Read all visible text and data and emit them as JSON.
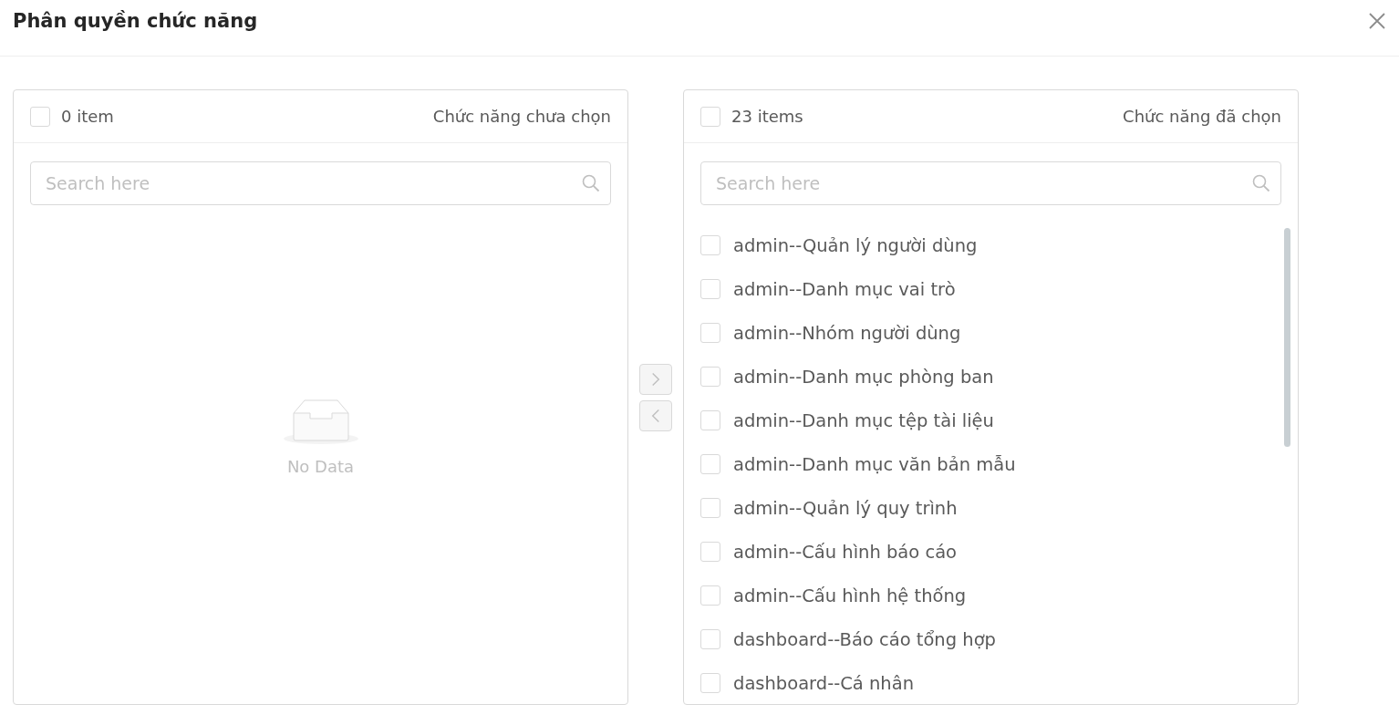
{
  "dialog": {
    "title": "Phân quyền chức năng"
  },
  "transfer": {
    "panels": [
      {
        "count": "0 item",
        "title": "Chức năng chưa chọn",
        "checked": false,
        "search": {
          "placeholder": "Search here"
        },
        "empty_text": "No Data"
      },
      {
        "count": "23 items",
        "title": "Chức năng đã chọn",
        "checked": false,
        "search": {
          "placeholder": "Search here"
        },
        "items": [
          {
            "label": "admin--Quản lý người dùng",
            "checked": false
          },
          {
            "label": "admin--Danh mục vai trò",
            "checked": false
          },
          {
            "label": "admin--Nhóm người dùng",
            "checked": false
          },
          {
            "label": "admin--Danh mục phòng ban",
            "checked": false
          },
          {
            "label": "admin--Danh mục tệp tài liệu",
            "checked": false
          },
          {
            "label": "admin--Danh mục văn bản mẫu",
            "checked": false
          },
          {
            "label": "admin--Quản lý quy trình",
            "checked": false
          },
          {
            "label": "admin--Cấu hình báo cáo",
            "checked": false
          },
          {
            "label": "admin--Cấu hình hệ thống",
            "checked": false
          },
          {
            "label": "dashboard--Báo cáo tổng hợp",
            "checked": false
          },
          {
            "label": "dashboard--Cá nhân",
            "checked": false
          }
        ]
      }
    ],
    "buttons": [
      {
        "kind": "right",
        "disabled": true
      },
      {
        "kind": "left",
        "disabled": true
      }
    ]
  }
}
